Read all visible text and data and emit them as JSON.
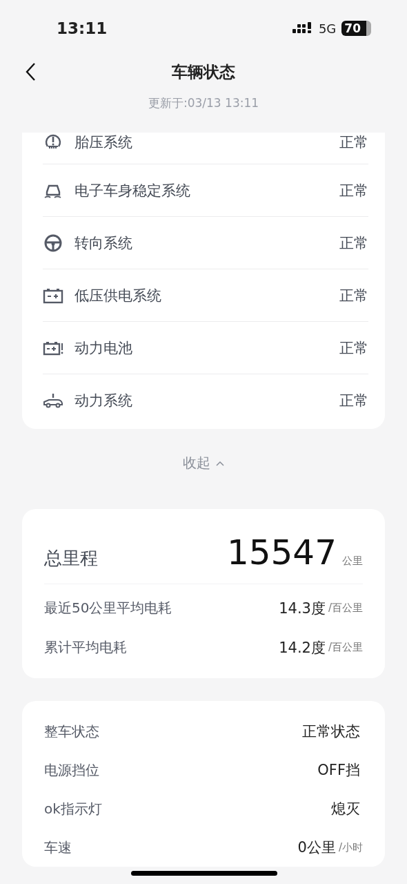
{
  "status_bar": {
    "time": "13:11",
    "network": "5G",
    "battery": "70"
  },
  "header": {
    "title": "车辆状态",
    "updated": "更新于:03/13 13:11"
  },
  "systems": [
    {
      "name": "胎压系统",
      "status": "正常"
    },
    {
      "name": "电子车身稳定系统",
      "status": "正常"
    },
    {
      "name": "转向系统",
      "status": "正常"
    },
    {
      "name": "低压供电系统",
      "status": "正常"
    },
    {
      "name": "动力电池",
      "status": "正常"
    },
    {
      "name": "动力系统",
      "status": "正常"
    }
  ],
  "collapse": {
    "label": "收起"
  },
  "mileage": {
    "label": "总里程",
    "value": "15547",
    "unit": "公里",
    "rows": [
      {
        "label": "最近50公里平均电耗",
        "value": "14.3度",
        "unit": "/百公里"
      },
      {
        "label": "累计平均电耗",
        "value": "14.2度",
        "unit": "/百公里"
      }
    ]
  },
  "vehicle": [
    {
      "label": "整车状态",
      "value": "正常状态"
    },
    {
      "label": "电源挡位",
      "value": "OFF挡"
    },
    {
      "label": "ok指示灯",
      "value": "熄灭"
    },
    {
      "label": "车速",
      "value": "0公里",
      "unit": "/小时"
    }
  ]
}
